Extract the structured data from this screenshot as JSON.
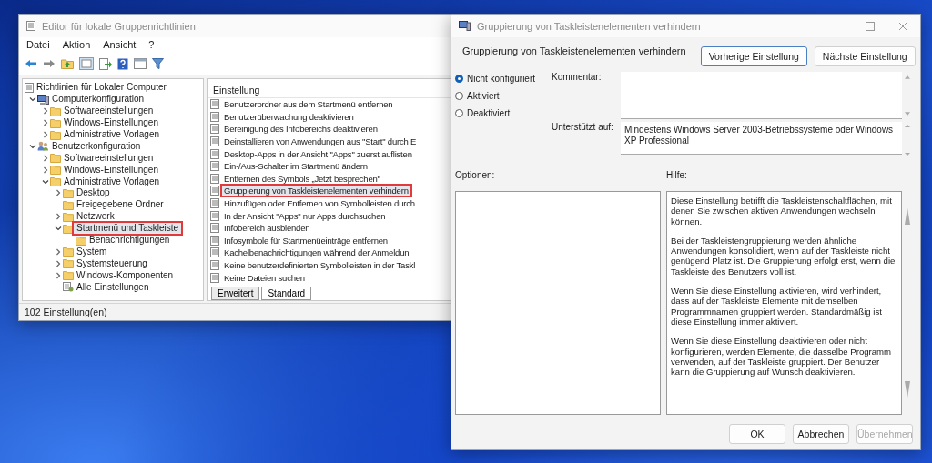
{
  "editor": {
    "title": "Editor für lokale Gruppenrichtlinien",
    "menu": [
      "Datei",
      "Aktion",
      "Ansicht",
      "?"
    ],
    "tree": {
      "label": "Richtlinien für Lokaler Computer",
      "kind": "policy",
      "selected": false,
      "children": [
        {
          "label": "Computerkonfiguration",
          "kind": "computer",
          "expanded": true,
          "selected": false,
          "children": [
            {
              "label": "Softwareeinstellungen",
              "kind": "folder",
              "expanded": false,
              "selected": false
            },
            {
              "label": "Windows-Einstellungen",
              "kind": "folder",
              "expanded": false,
              "selected": false
            },
            {
              "label": "Administrative Vorlagen",
              "kind": "folder",
              "expanded": false,
              "selected": false
            }
          ]
        },
        {
          "label": "Benutzerkonfiguration",
          "kind": "user",
          "expanded": true,
          "selected": false,
          "children": [
            {
              "label": "Softwareeinstellungen",
              "kind": "folder",
              "expanded": false,
              "selected": false
            },
            {
              "label": "Windows-Einstellungen",
              "kind": "folder",
              "expanded": false,
              "selected": false
            },
            {
              "label": "Administrative Vorlagen",
              "kind": "folder",
              "expanded": true,
              "selected": false,
              "children": [
                {
                  "label": "Desktop",
                  "kind": "folder",
                  "expanded": false,
                  "selected": false
                },
                {
                  "label": "Freigegebene Ordner",
                  "kind": "folder",
                  "selected": false
                },
                {
                  "label": "Netzwerk",
                  "kind": "folder",
                  "expanded": false,
                  "selected": false
                },
                {
                  "label": "Startmenü und Taskleiste",
                  "kind": "folder",
                  "expanded": true,
                  "selected": true,
                  "children": [
                    {
                      "label": "Benachrichtigungen",
                      "kind": "folder",
                      "selected": false
                    }
                  ]
                },
                {
                  "label": "System",
                  "kind": "folder",
                  "expanded": false,
                  "selected": false
                },
                {
                  "label": "Systemsteuerung",
                  "kind": "folder",
                  "expanded": false,
                  "selected": false
                },
                {
                  "label": "Windows-Komponenten",
                  "kind": "folder",
                  "expanded": false,
                  "selected": false
                },
                {
                  "label": "Alle Einstellungen",
                  "kind": "settings",
                  "selected": false
                }
              ]
            }
          ]
        }
      ]
    },
    "list": {
      "column": "Einstellung",
      "items": [
        {
          "label": "Benutzerordner aus dem Startmenü entfernen",
          "selected": false
        },
        {
          "label": "Benutzerüberwachung deaktivieren",
          "selected": false
        },
        {
          "label": "Bereinigung des Infobereichs deaktivieren",
          "selected": false
        },
        {
          "label": "Deinstallieren von Anwendungen aus \"Start\" durch E",
          "selected": false
        },
        {
          "label": "Desktop-Apps in der Ansicht \"Apps\" zuerst auflisten",
          "selected": false
        },
        {
          "label": "Ein-/Aus-Schalter im Startmenü ändern",
          "selected": false
        },
        {
          "label": "Entfernen des Symbols „Jetzt besprechen\"",
          "selected": false
        },
        {
          "label": "Gruppierung von Taskleistenelementen verhindern",
          "selected": true
        },
        {
          "label": "Hinzufügen oder Entfernen von Symbolleisten durch",
          "selected": false
        },
        {
          "label": "In der Ansicht \"Apps\" nur Apps durchsuchen",
          "selected": false
        },
        {
          "label": "Infobereich ausblenden",
          "selected": false
        },
        {
          "label": "Infosymbole für Startmenüeinträge entfernen",
          "selected": false
        },
        {
          "label": "Kachelbenachrichtigungen während der Anmeldun",
          "selected": false
        },
        {
          "label": "Keine benutzerdefinierten Symbolleisten in der Taskl",
          "selected": false
        },
        {
          "label": "Keine Dateien suchen",
          "selected": false
        }
      ]
    },
    "tabs": [
      {
        "label": "Erweitert",
        "selected": false
      },
      {
        "label": "Standard",
        "selected": true
      }
    ],
    "status_bar": "102 Einstellung(en)"
  },
  "dialog": {
    "title": "Gruppierung von Taskleistenelementen verhindern",
    "heading": "Gruppierung von Taskleistenelementen verhindern",
    "nav_buttons": [
      {
        "label": "Vorherige Einstellung",
        "selected": true
      },
      {
        "label": "Nächste Einstellung",
        "selected": false
      }
    ],
    "options": [
      {
        "label": "Nicht konfiguriert",
        "selected": true
      },
      {
        "label": "Aktiviert",
        "selected": false
      },
      {
        "label": "Deaktiviert",
        "selected": false
      }
    ],
    "comment_label": "Kommentar:",
    "supported_label": "Unterstützt auf:",
    "supported_text": "Mindestens Windows Server 2003-Betriebssysteme oder Windows XP Professional",
    "options_label": "Optionen:",
    "help_label": "Hilfe:",
    "help_paragraphs": [
      "Diese Einstellung betrifft die Taskleistenschaltflächen, mit denen Sie zwischen aktiven Anwendungen wechseln können.",
      "Bei der Taskleistengruppierung werden ähnliche Anwendungen konsolidiert, wenn auf der Taskleiste nicht genügend Platz ist. Die Gruppierung erfolgt erst, wenn die Taskleiste des Benutzers voll ist.",
      "Wenn Sie diese Einstellung aktivieren, wird verhindert, dass auf der Taskleiste Elemente mit demselben Programmnamen gruppiert werden. Standardmäßig ist diese Einstellung immer aktiviert.",
      "Wenn Sie diese Einstellung deaktivieren oder nicht konfigurieren, werden Elemente, die dasselbe Programm verwenden, auf der Taskleiste gruppiert. Der Benutzer kann die Gruppierung auf Wunsch deaktivieren."
    ],
    "buttons": [
      {
        "label": "OK",
        "disabled": false
      },
      {
        "label": "Abbrechen",
        "disabled": false
      },
      {
        "label": "Übernehmen",
        "disabled": true
      }
    ]
  }
}
